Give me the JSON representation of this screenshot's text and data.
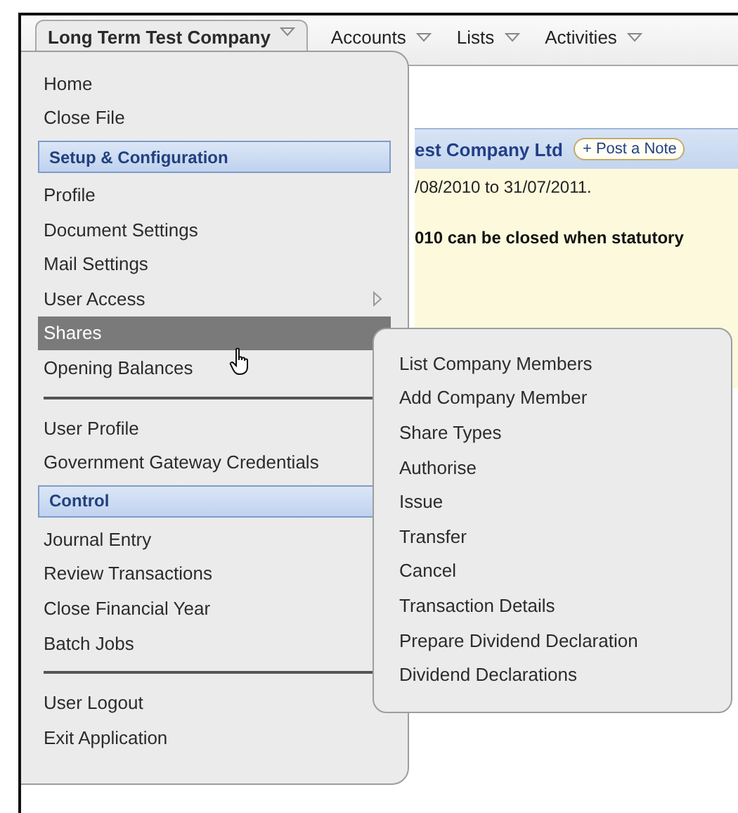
{
  "menubar": {
    "items": [
      {
        "label": "Long Term Test Company",
        "selected": true
      },
      {
        "label": "Accounts",
        "selected": false
      },
      {
        "label": "Lists",
        "selected": false
      },
      {
        "label": "Activities",
        "selected": false
      }
    ]
  },
  "content": {
    "title": "est Company Ltd",
    "note_button": "+ Post a Note",
    "period": "/08/2010 to 31/07/2011.",
    "notice": "010 can be closed when statutory"
  },
  "menu": {
    "items": [
      {
        "kind": "item",
        "label": "Home",
        "selected": false
      },
      {
        "kind": "item",
        "label": "Close File",
        "selected": false
      },
      {
        "kind": "header",
        "label": "Setup & Configuration"
      },
      {
        "kind": "item",
        "label": "Profile",
        "selected": false
      },
      {
        "kind": "item",
        "label": "Document Settings",
        "selected": false
      },
      {
        "kind": "item",
        "label": "Mail Settings",
        "selected": false
      },
      {
        "kind": "submenu_item",
        "label": "User Access",
        "selected": false
      },
      {
        "kind": "item",
        "label": "Shares",
        "selected": true
      },
      {
        "kind": "item",
        "label": "Opening Balances",
        "selected": false
      },
      {
        "kind": "divider"
      },
      {
        "kind": "item",
        "label": "User Profile",
        "selected": false
      },
      {
        "kind": "item",
        "label": "Government Gateway Credentials",
        "selected": false
      },
      {
        "kind": "header",
        "label": "Control"
      },
      {
        "kind": "item",
        "label": "Journal Entry",
        "selected": false
      },
      {
        "kind": "item",
        "label": "Review Transactions",
        "selected": false
      },
      {
        "kind": "item",
        "label": "Close Financial Year",
        "selected": false
      },
      {
        "kind": "item",
        "label": "Batch Jobs",
        "selected": false
      },
      {
        "kind": "divider"
      },
      {
        "kind": "item",
        "label": "User Logout",
        "selected": false
      },
      {
        "kind": "item",
        "label": "Exit Application",
        "selected": false
      }
    ]
  },
  "submenu": {
    "items": [
      {
        "label": "List Company Members"
      },
      {
        "label": "Add Company Member"
      },
      {
        "label": "Share Types"
      },
      {
        "label": "Authorise"
      },
      {
        "label": "Issue"
      },
      {
        "label": "Transfer"
      },
      {
        "label": "Cancel"
      },
      {
        "label": "Transaction Details"
      },
      {
        "label": "Prepare Dividend Declaration"
      },
      {
        "label": "Dividend Declarations"
      }
    ]
  }
}
